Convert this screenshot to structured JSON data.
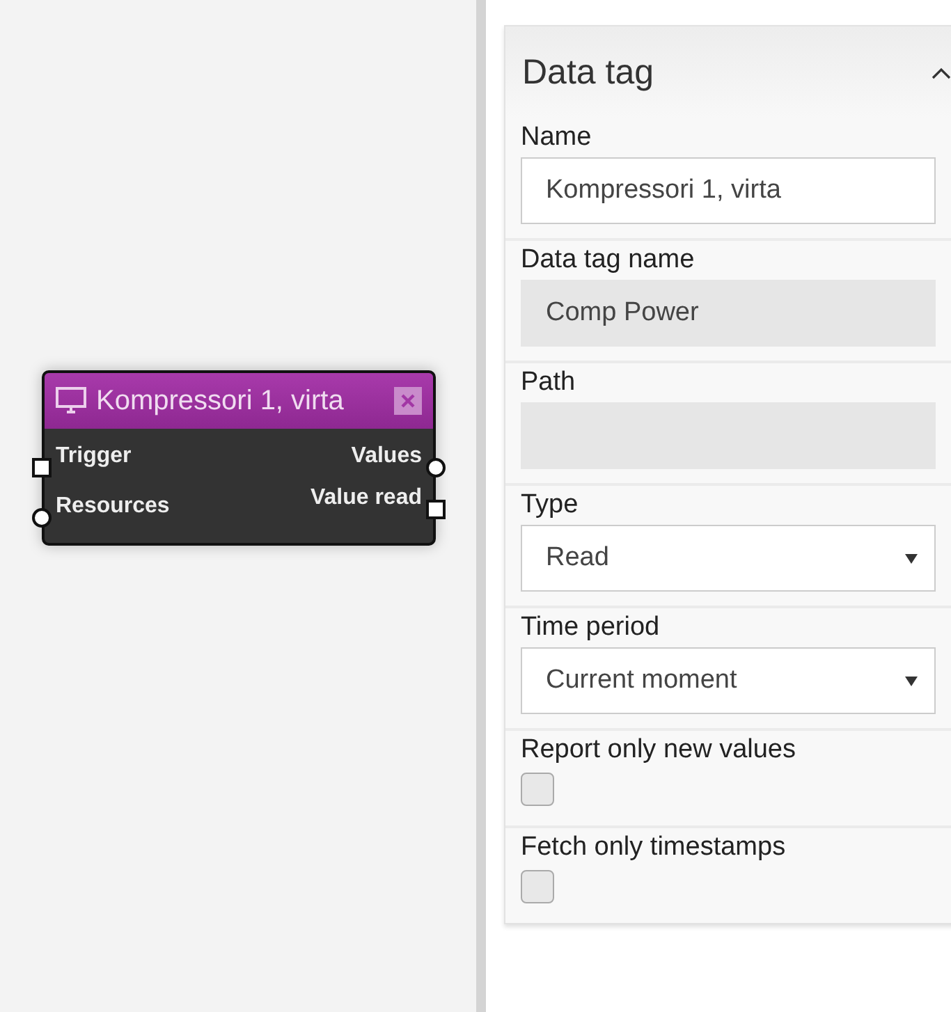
{
  "node": {
    "title": "Kompressori 1, virta",
    "inputs": [
      {
        "label": "Trigger",
        "kind": "square"
      },
      {
        "label": "Resources",
        "kind": "circle"
      }
    ],
    "outputs": [
      {
        "label": "Values",
        "kind": "circle"
      },
      {
        "label": "Value read",
        "kind": "square"
      }
    ]
  },
  "panel": {
    "title": "Data tag",
    "expanded": true,
    "fields": [
      {
        "label": "Name",
        "kind": "text",
        "value": "Kompressori 1, virta"
      },
      {
        "label": "Data tag name",
        "kind": "readonly",
        "value": "Comp Power"
      },
      {
        "label": "Path",
        "kind": "readonly"
      },
      {
        "label": "Type",
        "kind": "select",
        "value": "Read"
      },
      {
        "label": "Time period",
        "kind": "select",
        "value": "Current moment"
      },
      {
        "label": "Report only new values",
        "kind": "checkbox",
        "checked": false
      },
      {
        "label": "Fetch only timestamps",
        "kind": "checkbox",
        "checked": false
      }
    ]
  }
}
